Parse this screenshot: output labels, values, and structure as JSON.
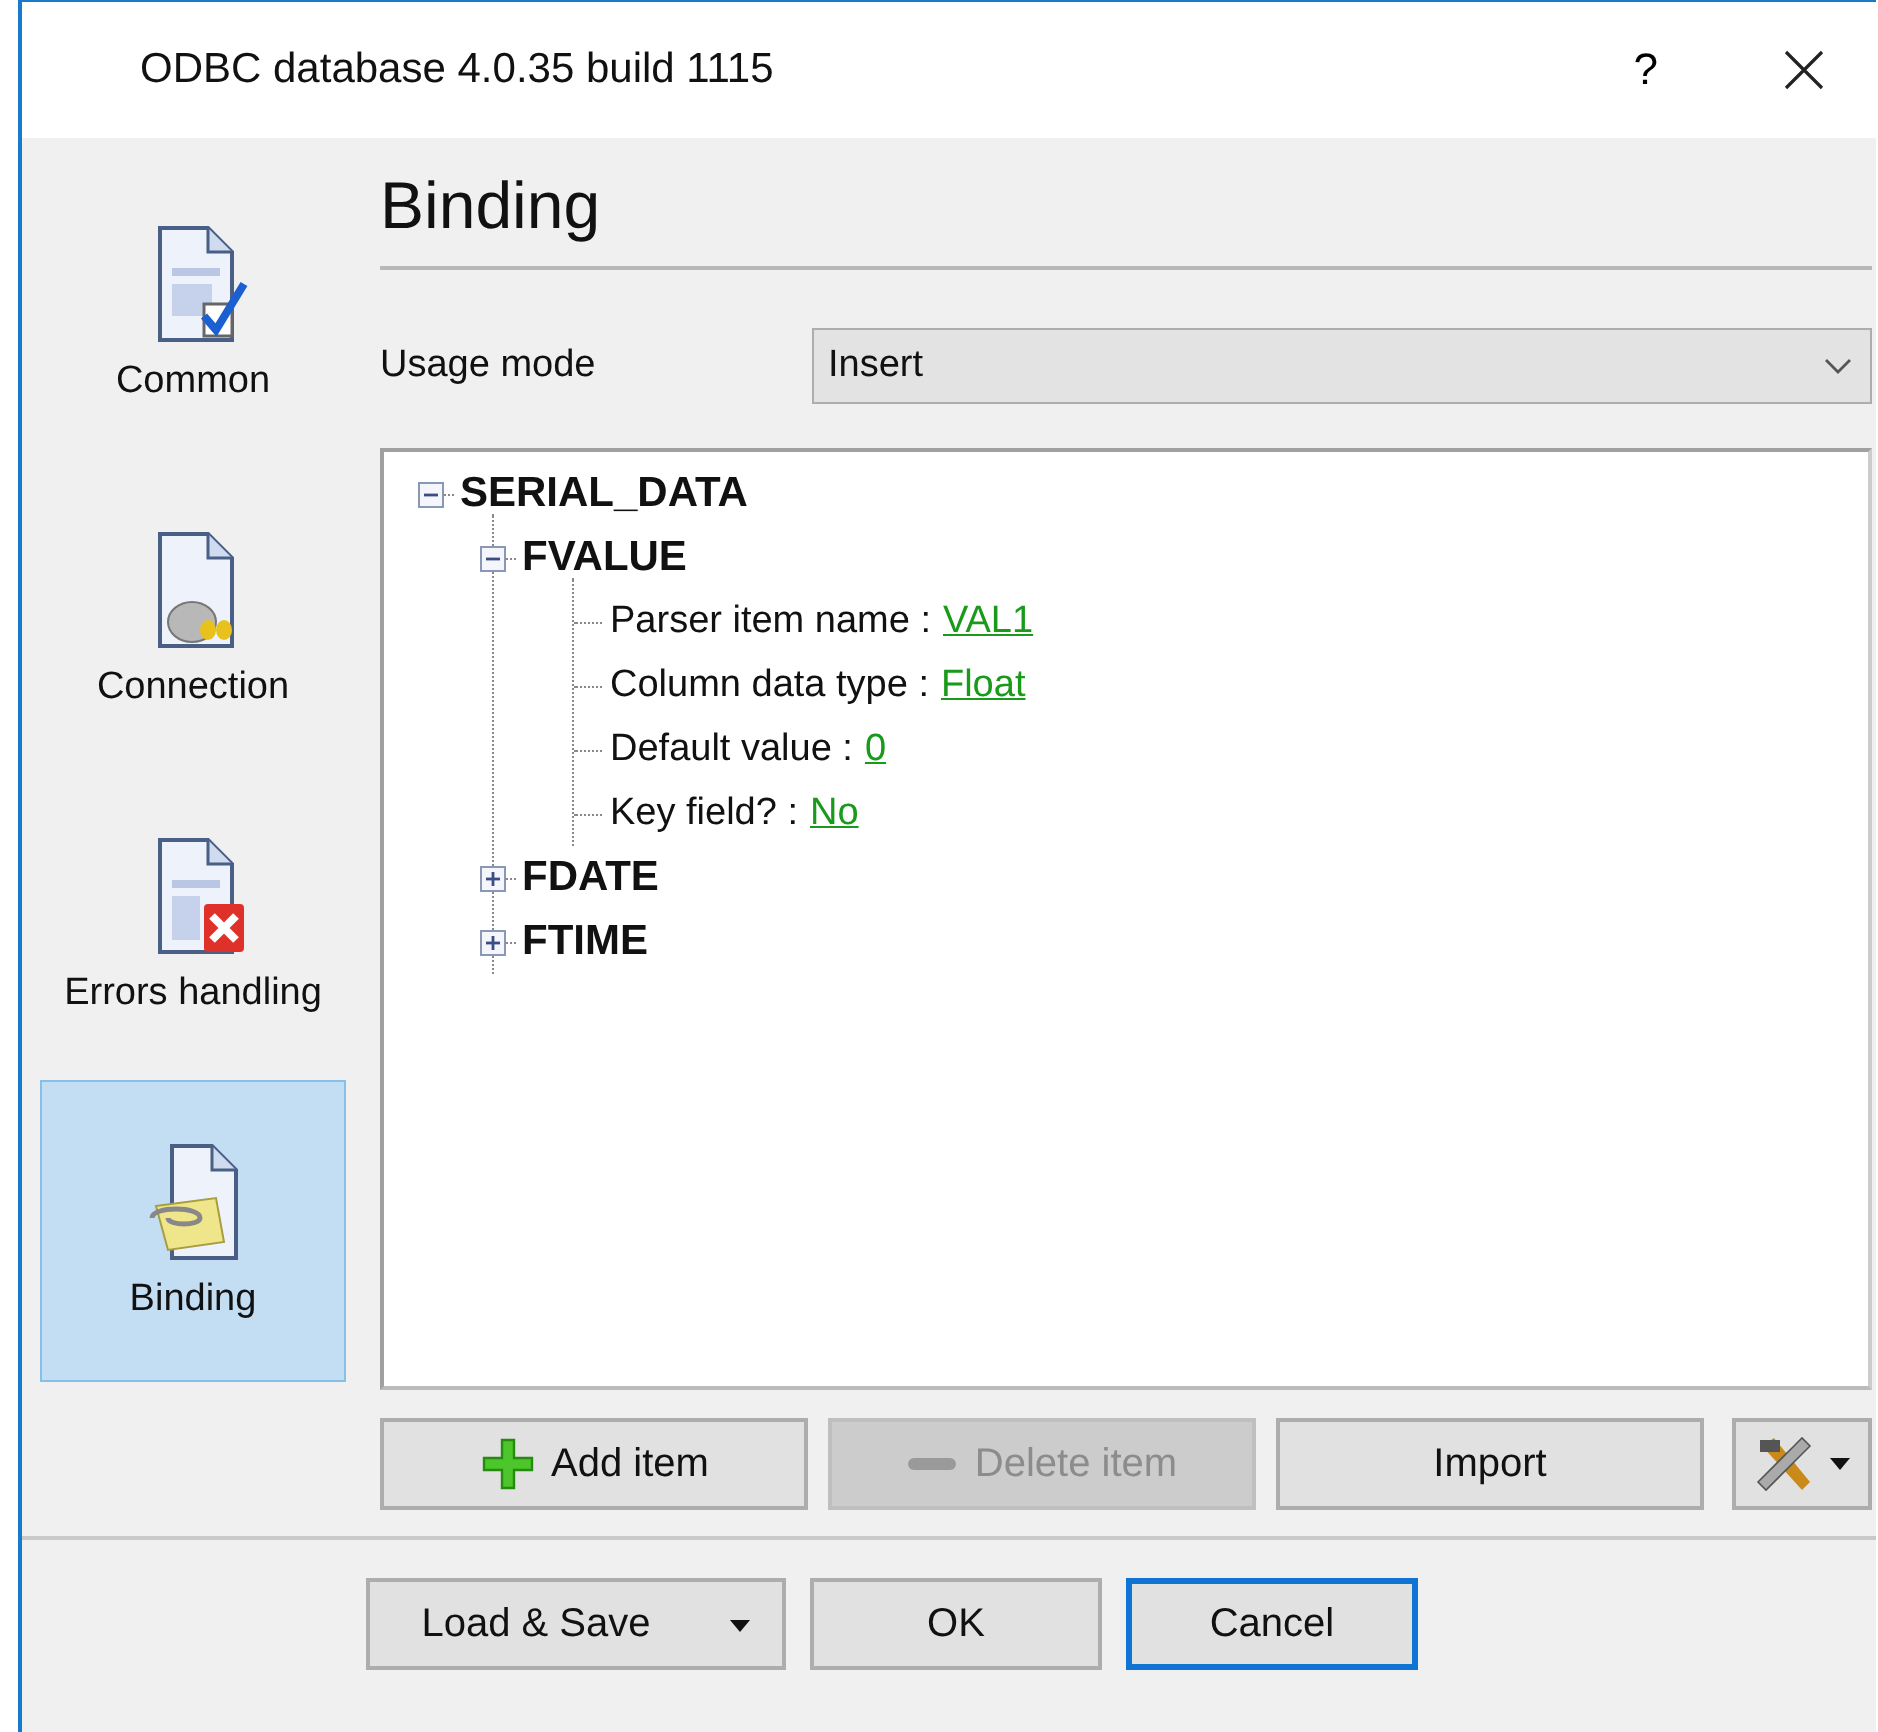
{
  "window": {
    "title": "ODBC database 4.0.35 build 1115",
    "help": "?"
  },
  "sidebar": {
    "items": [
      {
        "label": "Common",
        "selected": false
      },
      {
        "label": "Connection",
        "selected": false
      },
      {
        "label": "Errors handling",
        "selected": false
      },
      {
        "label": "Binding",
        "selected": true
      }
    ]
  },
  "page": {
    "heading": "Binding",
    "usage_mode": {
      "label": "Usage mode",
      "value": "Insert"
    }
  },
  "tree": [
    {
      "label": "SERIAL_DATA",
      "expanded": true,
      "children": [
        {
          "label": "FVALUE",
          "expanded": true,
          "properties": [
            {
              "name": "Parser item name :",
              "value": "VAL1"
            },
            {
              "name": "Column data type :",
              "value": "Float"
            },
            {
              "name": "Default value :",
              "value": "0"
            },
            {
              "name": "Key field? :",
              "value": "No"
            }
          ]
        },
        {
          "label": "FDATE",
          "expanded": false
        },
        {
          "label": "FTIME",
          "expanded": false
        }
      ]
    }
  ],
  "tree_buttons": [
    {
      "label": "Add item",
      "kind": "add",
      "disabled": false
    },
    {
      "label": "Delete item",
      "kind": "delete",
      "disabled": true
    },
    {
      "label": "Import",
      "kind": "plain",
      "disabled": false
    }
  ],
  "footer_buttons": [
    {
      "label": "Load & Save",
      "kind": "dropdown",
      "focused": false
    },
    {
      "label": "OK",
      "kind": "plain",
      "focused": false
    },
    {
      "label": "Cancel",
      "kind": "plain",
      "focused": true
    }
  ]
}
